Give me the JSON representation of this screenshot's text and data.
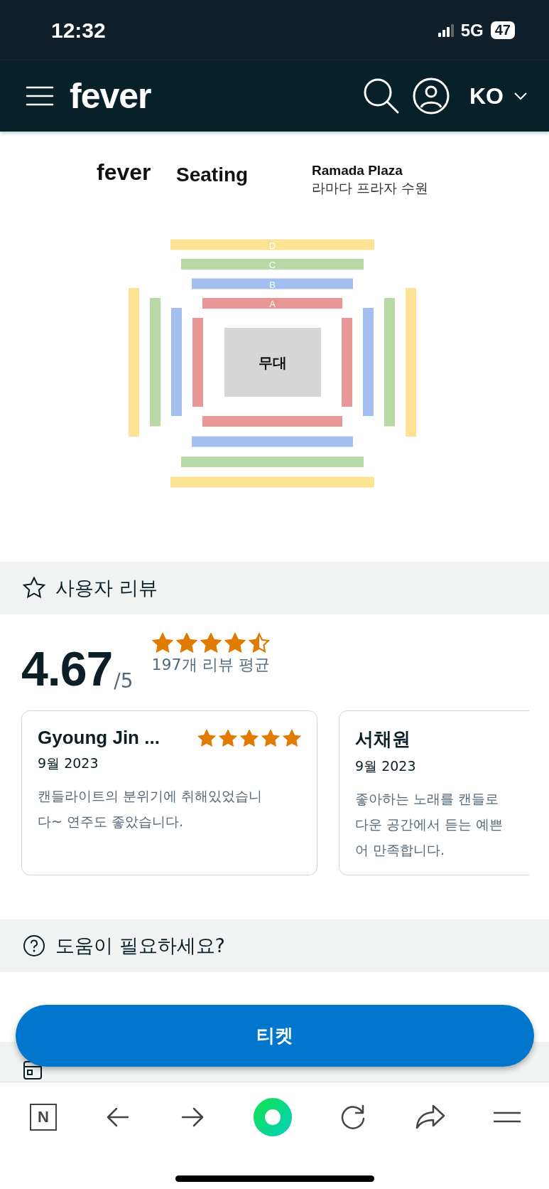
{
  "status_bar": {
    "time": "12:32",
    "network": "5G",
    "battery": "47"
  },
  "nav": {
    "logo": "fever",
    "language": "KO"
  },
  "seating": {
    "brand": "fever",
    "title": "Seating",
    "venue": "Ramada Plaza",
    "venue_local": "라마다 프라자 수원",
    "stage": "무대",
    "sections": [
      {
        "label": "D",
        "color": "#fde294"
      },
      {
        "label": "C",
        "color": "#b8d8a6"
      },
      {
        "label": "B",
        "color": "#a3bff0"
      },
      {
        "label": "A",
        "color": "#e99696"
      }
    ]
  },
  "reviews": {
    "heading": "사용자 리뷰",
    "score": "4.67",
    "scale": "/5",
    "stars": 4.5,
    "count": "197개 리뷰 평균",
    "items": [
      {
        "name": "Gyoung Jin ...",
        "date": "9월 2023",
        "stars": 5,
        "text_lines": [
          "캔들라이트의 분위기에 취해있었습니",
          "다~ 연주도 좋았습니다."
        ]
      },
      {
        "name": "서채원",
        "date": "9월 2023",
        "text_lines": [
          "좋아하는 노래를 캔들로",
          "다운 공간에서 듣는 예쁜",
          "어 만족합니다."
        ]
      }
    ]
  },
  "help": {
    "heading": "도움이 필요하세요?"
  },
  "ticket_button": "티켓",
  "toolbar": {
    "n_key": "N"
  }
}
